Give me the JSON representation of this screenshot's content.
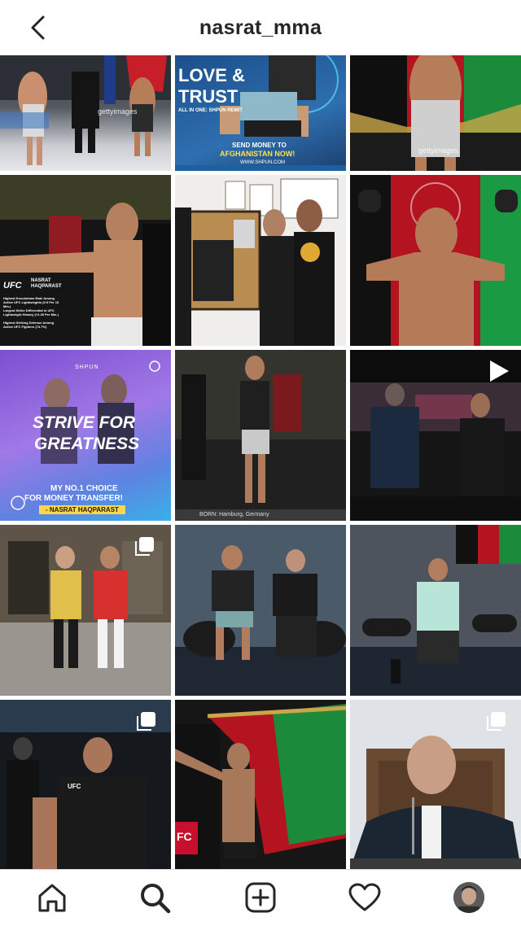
{
  "header": {
    "title": "nasrat_mma"
  },
  "posts": [
    {
      "watermark": "gettyimages"
    },
    {
      "headline_line1": "LOVE &",
      "headline_line2": "TRUST",
      "tagline": "ALL IN ONE: SHPUN REMIT",
      "cta_line1": "SEND MONEY TO",
      "cta_line2": "AFGHANISTAN NOW!",
      "url": "WWW.SHPUN.COM"
    },
    {
      "watermark": "gettyimages"
    },
    {
      "brand": "UFC",
      "name_line1": "NASRAT",
      "name_line2": "HAQPARAST",
      "stat1": "Highest Knockdown Rate Among Active UFC Lightweights (0.9 Per 15 Min.)",
      "stat2": "Largest Strike Differential in UFC Lightweight History (+2.45 Per Min.)",
      "stat3": "Highest Striking Defense Among Active UFC Fighters (74.7%)"
    },
    {},
    {},
    {
      "brand": "SHPUN",
      "headline_line1": "STRIVE FOR",
      "headline_line2": "GREATNESS",
      "sub_line1": "MY NO.1 CHOICE",
      "sub_line2": "FOR MONEY TRANSFER!",
      "signature": "- NASRAT HAQPARAST"
    },
    {
      "caption": "BORN: Hamburg, Germany"
    },
    {
      "type": "video"
    },
    {
      "type": "carousel"
    },
    {},
    {},
    {
      "type": "carousel",
      "brand": "UFC"
    },
    {
      "brand": "FC"
    },
    {
      "type": "carousel"
    }
  ],
  "nav": {
    "items": [
      "home",
      "search",
      "new-post",
      "activity",
      "profile"
    ]
  }
}
